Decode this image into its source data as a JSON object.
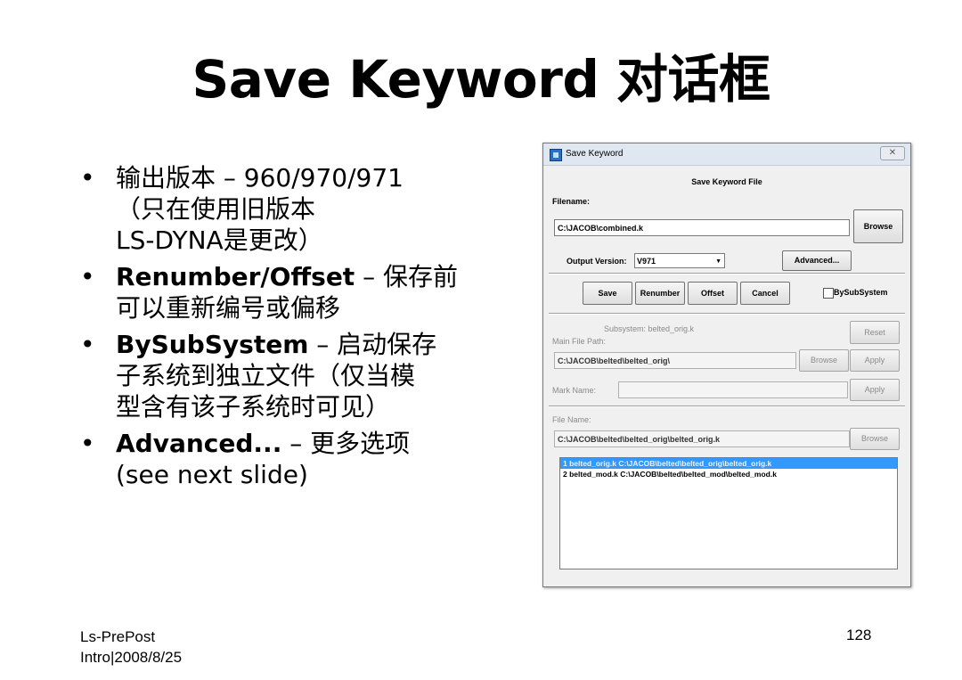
{
  "slide": {
    "title": "Save Keyword 对话框",
    "bullets": [
      {
        "bold": "",
        "lines": [
          "输出版本 – 960/970/971",
          "（只在使用旧版本",
          "LS‐DYNA是更改）"
        ]
      },
      {
        "bold": "Renumber/Offset",
        "lines": [
          " – 保存前",
          "可以重新编号或偏移"
        ]
      },
      {
        "bold": "BySubSystem",
        "lines": [
          " – 启动保存",
          "子系统到独立文件（仅当模",
          "型含有该子系统时可见）"
        ]
      },
      {
        "bold": "Advanced...",
        "lines": [
          " – 更多选项",
          "(see next slide)"
        ]
      }
    ],
    "bullet_symbol": "•",
    "footer_left_1": "Ls-PrePost",
    "footer_left_2": "Intro|2008/8/25",
    "page_number": "128"
  },
  "dialog": {
    "title": "Save Keyword",
    "close_symbol": "✕",
    "section_title": "Save Keyword File",
    "filename_label": "Filename:",
    "filename_value": "C:\\JACOB\\combined.k",
    "browse_label": "Browse",
    "output_version_label": "Output Version:",
    "output_version_value": "V971",
    "advanced_label": "Advanced...",
    "save_label": "Save",
    "renumber_label": "Renumber",
    "offset_label": "Offset",
    "cancel_label": "Cancel",
    "bysubsystem_label": "BySubSystem",
    "subsystem_label": "Subsystem: belted_orig.k",
    "main_file_path_label": "Main File Path:",
    "main_file_path_value": "C:\\JACOB\\belted\\belted_orig\\",
    "reset_label": "Reset",
    "browse_disabled_label": "Browse",
    "apply_label": "Apply",
    "mark_name_label": "Mark Name:",
    "apply2_label": "Apply",
    "file_name_label": "File Name:",
    "file_name_value": "C:\\JACOB\\belted\\belted_orig\\belted_orig.k",
    "browse3_label": "Browse",
    "list_items": [
      "1 belted_orig.k C:\\JACOB\\belted\\belted_orig\\belted_orig.k",
      "2 belted_mod.k C:\\JACOB\\belted\\belted_mod\\belted_mod.k"
    ]
  }
}
